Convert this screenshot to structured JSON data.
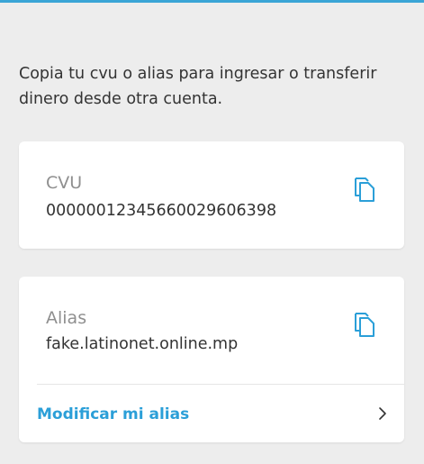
{
  "colors": {
    "accent": "#2b9fd8",
    "background": "#ededed",
    "card": "#ffffff",
    "label": "#8f8f8f",
    "text": "#333333"
  },
  "intro": {
    "text": "Copia tu cvu o alias para ingresar o transferir dinero desde otra cuenta."
  },
  "cvu_card": {
    "label": "CVU",
    "value": "0000001234566002960​6398",
    "copy_icon": "copy-icon"
  },
  "alias_card": {
    "label": "Alias",
    "value": "fake.latinonet.online.mp",
    "copy_icon": "copy-icon",
    "modify_label": "Modificar mi alias",
    "modify_icon": "chevron-right-icon"
  }
}
